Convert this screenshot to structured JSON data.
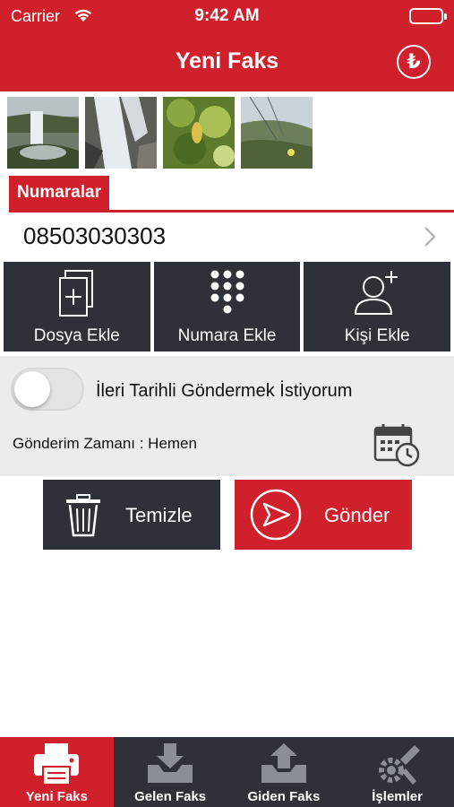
{
  "status": {
    "carrier": "Carrier",
    "time": "9:42 AM"
  },
  "header": {
    "title": "Yeni Faks",
    "currency_symbol": "₺"
  },
  "attachments": [
    {
      "name": "waterfall-photo-1"
    },
    {
      "name": "waterfall-photo-2"
    },
    {
      "name": "leaves-photo"
    },
    {
      "name": "meadow-photo"
    }
  ],
  "numbers": {
    "section_label": "Numaralar",
    "phone_number": "08503030303"
  },
  "actions": {
    "add_file": "Dosya Ekle",
    "add_number": "Numara Ekle",
    "add_contact": "Kişi Ekle"
  },
  "schedule": {
    "toggle_label": "İleri Tarihli Göndermek İstiyorum",
    "toggle_on": false,
    "send_time": "Gönderim Zamanı : Hemen"
  },
  "buttons": {
    "clear": "Temizle",
    "send": "Gönder"
  },
  "tabs": [
    {
      "label": "Yeni Faks",
      "icon": "fax-icon",
      "active": true
    },
    {
      "label": "Gelen Faks",
      "icon": "inbox-download-icon",
      "active": false
    },
    {
      "label": "Giden Faks",
      "icon": "outbox-upload-icon",
      "active": false
    },
    {
      "label": "İşlemler",
      "icon": "tools-gear-icon",
      "active": false
    }
  ],
  "colors": {
    "brand_red": "#d0202b",
    "dark": "#2e3238",
    "panel_gray": "#ececec"
  }
}
